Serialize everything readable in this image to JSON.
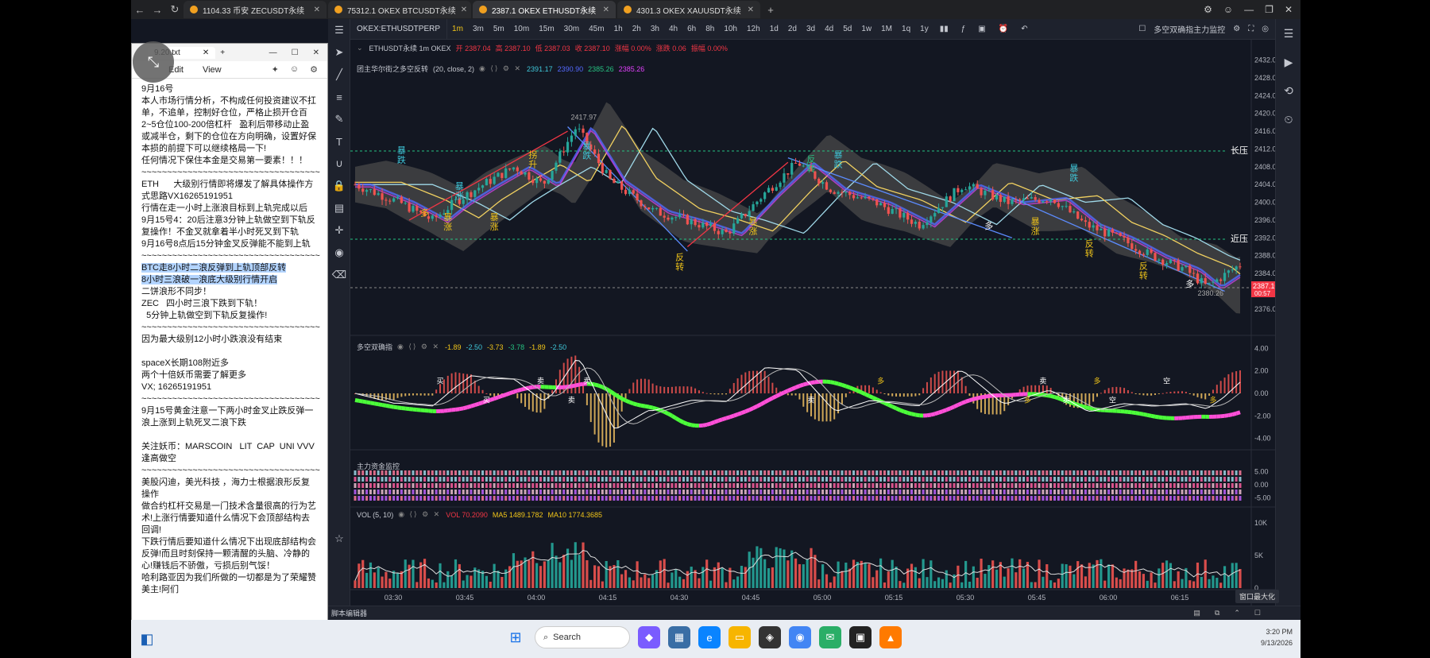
{
  "browser": {
    "tabs": [
      {
        "label": "1104.33 币安 ZECUSDT永续",
        "active": false
      },
      {
        "label": "75312.1 OKEX BTCUSDT永续",
        "active": false
      },
      {
        "label": "2387.1 OKEX ETHUSDT永续",
        "active": true
      },
      {
        "label": "4301.3 OKEX XAUUSDT永续",
        "active": false
      }
    ],
    "new_tab": "+"
  },
  "toolbar": {
    "symbol": "OKEX:ETHUSDTPERP",
    "timeframes": [
      "1m",
      "3m",
      "5m",
      "10m",
      "15m",
      "30m",
      "45m",
      "1h",
      "2h",
      "3h",
      "4h",
      "6h",
      "8h",
      "10h",
      "12h",
      "1d",
      "2d",
      "3d",
      "4d",
      "5d",
      "1w",
      "1M",
      "1q",
      "1y"
    ],
    "active_timeframe": "1m",
    "indicator_menu": "多空双确指主力监控"
  },
  "main_legend": {
    "title": "ETHUSDT永续 1m OKEX",
    "open": "开 2387.04",
    "high": "高 2387.10",
    "low": "低 2387.03",
    "close": "收 2387.10",
    "change_pct": "涨幅 0.00%",
    "change": "涨跌 0.06",
    "amplitude": "振幅 0.00%"
  },
  "indicator_legend": {
    "name": "团主华尔街之多空反转",
    "params": "(20, close, 2)",
    "v1": "2391.17",
    "v2": "2390.90",
    "v3": "2385.26",
    "v4": "2385.26"
  },
  "macd_legend": {
    "name": "多空双确指",
    "values": [
      "-1.89",
      "-2.50",
      "-3.73",
      "-3.78",
      "-1.89",
      "-2.50"
    ]
  },
  "flow_legend": {
    "name": "主力资金监控"
  },
  "vol_legend": {
    "name": "VOL (5, 10)",
    "vol": "VOL 70.2090",
    "ma5": "MA5 1489.1782",
    "ma10": "MA10 1774.3685"
  },
  "price_axis": [
    "2432.00",
    "2428.00",
    "2424.00",
    "2420.00",
    "2416.00",
    "2412.00",
    "2408.00",
    "2404.00",
    "2400.00",
    "2396.00",
    "2392.00",
    "2388.00",
    "2384.00",
    "2380.00",
    "2376.00"
  ],
  "macd_axis": [
    "4.00",
    "2.00",
    "0.00",
    "-2.00",
    "-4.00"
  ],
  "flow_axis": [
    "5.00",
    "0.00",
    "-5.00"
  ],
  "vol_axis": [
    "10K",
    "5K",
    "0"
  ],
  "time_axis": [
    "03:30",
    "03:45",
    "04:00",
    "04:15",
    "04:30",
    "04:45",
    "05:00",
    "05:15",
    "05:30",
    "05:45",
    "06:00",
    "06:15",
    "06:26"
  ],
  "last_price": {
    "price": "2387.10",
    "countdown": "00:57"
  },
  "annotations": {
    "high_label": "2417.97",
    "low_label": "2380.26",
    "resistance_long": "长压",
    "resistance_near": "近压",
    "labels": [
      {
        "text": "暴跌",
        "color": "#3fc7d9"
      },
      {
        "text": "暴涨",
        "color": "#3fc7d9"
      },
      {
        "text": "多",
        "color": "#f0c419"
      },
      {
        "text": "暴涨",
        "color": "#f0c419"
      },
      {
        "text": "拐升",
        "color": "#f0c419"
      },
      {
        "text": "暴跌",
        "color": "#3fc7d9"
      },
      {
        "text": "暴涨",
        "color": "#f0c419"
      },
      {
        "text": "反转",
        "color": "#f0c419"
      },
      {
        "text": "暴涨",
        "color": "#f0c419"
      },
      {
        "text": "反转",
        "color": "#26c281"
      },
      {
        "text": "暴跌",
        "color": "#3fc7d9"
      },
      {
        "text": "多",
        "color": "#ffffff"
      },
      {
        "text": "暴涨",
        "color": "#f0c419"
      },
      {
        "text": "暴跌",
        "color": "#3fc7d9"
      },
      {
        "text": "反转",
        "color": "#f0c419"
      },
      {
        "text": "反转",
        "color": "#f0c419"
      },
      {
        "text": "多",
        "color": "#ffffff"
      }
    ],
    "macd_marks": [
      "买",
      "买",
      "卖",
      "卖",
      "卖",
      "卖",
      "多",
      "多",
      "卖",
      "卖",
      "多",
      "空",
      "空",
      "多"
    ]
  },
  "bottom_bar": {
    "left": "脚本编辑器",
    "tooltip": "窗口最大化"
  },
  "notepad": {
    "tab_title": "9.20.txt",
    "menu": [
      "Edit",
      "View"
    ],
    "lines": [
      "9月16号",
      "本人市场行情分析，不构成任何投资建议不扛单，不追单，控制好仓位，严格止损开仓百2~5仓位100-200倍杠杆   盈利后带移动止盈或减半仓，剩下的仓位在方向明确，设置好保本损的前提下可以继续格局一下!",
      "任何情况下保住本金是交易第一要素！！！",
      "~~~~~~~~~~~~~~~~~~~~~~~~~~~~~~~~~~~",
      "ETH      大级别行情即将爆发了解具体操作方式思路VX16265191951",
      "行情在走一小时上涨浪目标到上轨完成以后",
      "9月15号4：20后注意3分钟上轨做空到下轨反复操作！不金叉就拿着半小时死叉到下轨",
      "9月16号8点后15分钟金叉反弹能不能到上轨",
      "~~~~~~~~~~~~~~~~~~~~~~~~~~~~~~~~~~~"
    ],
    "highlight_lines": [
      "BTC走8小时二浪反弹到上轨顶部反转",
      "8小时三浪破一浪底大级别行情开启"
    ],
    "lines2": [
      "二饼浪形不同步！",
      "ZEC   四小时三浪下跌到下轨！",
      "  5分钟上轨做空到下轨反复操作!",
      "~~~~~~~~~~~~~~~~~~~~~~~~~~~~~~~~~~~",
      "因为最大级别12小时小跌浪没有结束",
      "",
      "spaceX长期108附近多",
      "两个十倍妖币需要了解更多",
      "VX; 16265191951",
      "~~~~~~~~~~~~~~~~~~~~~~~~~~~~~~~~~~~",
      "9月15号黄金注意一下两小时金叉止跌反弹一浪上涨到上轨死叉二浪下跌",
      "",
      "关注妖币：MARSCOIN   LIT  CAP  UNI VVV 逢高做空",
      "~~~~~~~~~~~~~~~~~~~~~~~~~~~~~~~~~~~",
      "美股闪迪，美光科技 ，海力士根据浪形反复操作",
      "做合约杠杆交易是一门技术含量很高的行为艺术!上涨行情要知道什么情况下会顶部结构去回调!",
      "下跌行情后要知道什么情况下出现底部结构会反弹!而且时刻保持一颗清醒的头脑、冷静的心!赚钱后不骄傲，亏损后别气馁！",
      "哈利路亚因为我们所做的一切都是为了荣耀赞美主!阿们"
    ]
  },
  "taskbar": {
    "search": "Search",
    "time": "3:20 PM",
    "date": "9/13/2026"
  },
  "colors": {
    "up": "#26a69a",
    "down": "#ef5350",
    "band": "#4a4a4a",
    "accent": "#f0c419"
  }
}
